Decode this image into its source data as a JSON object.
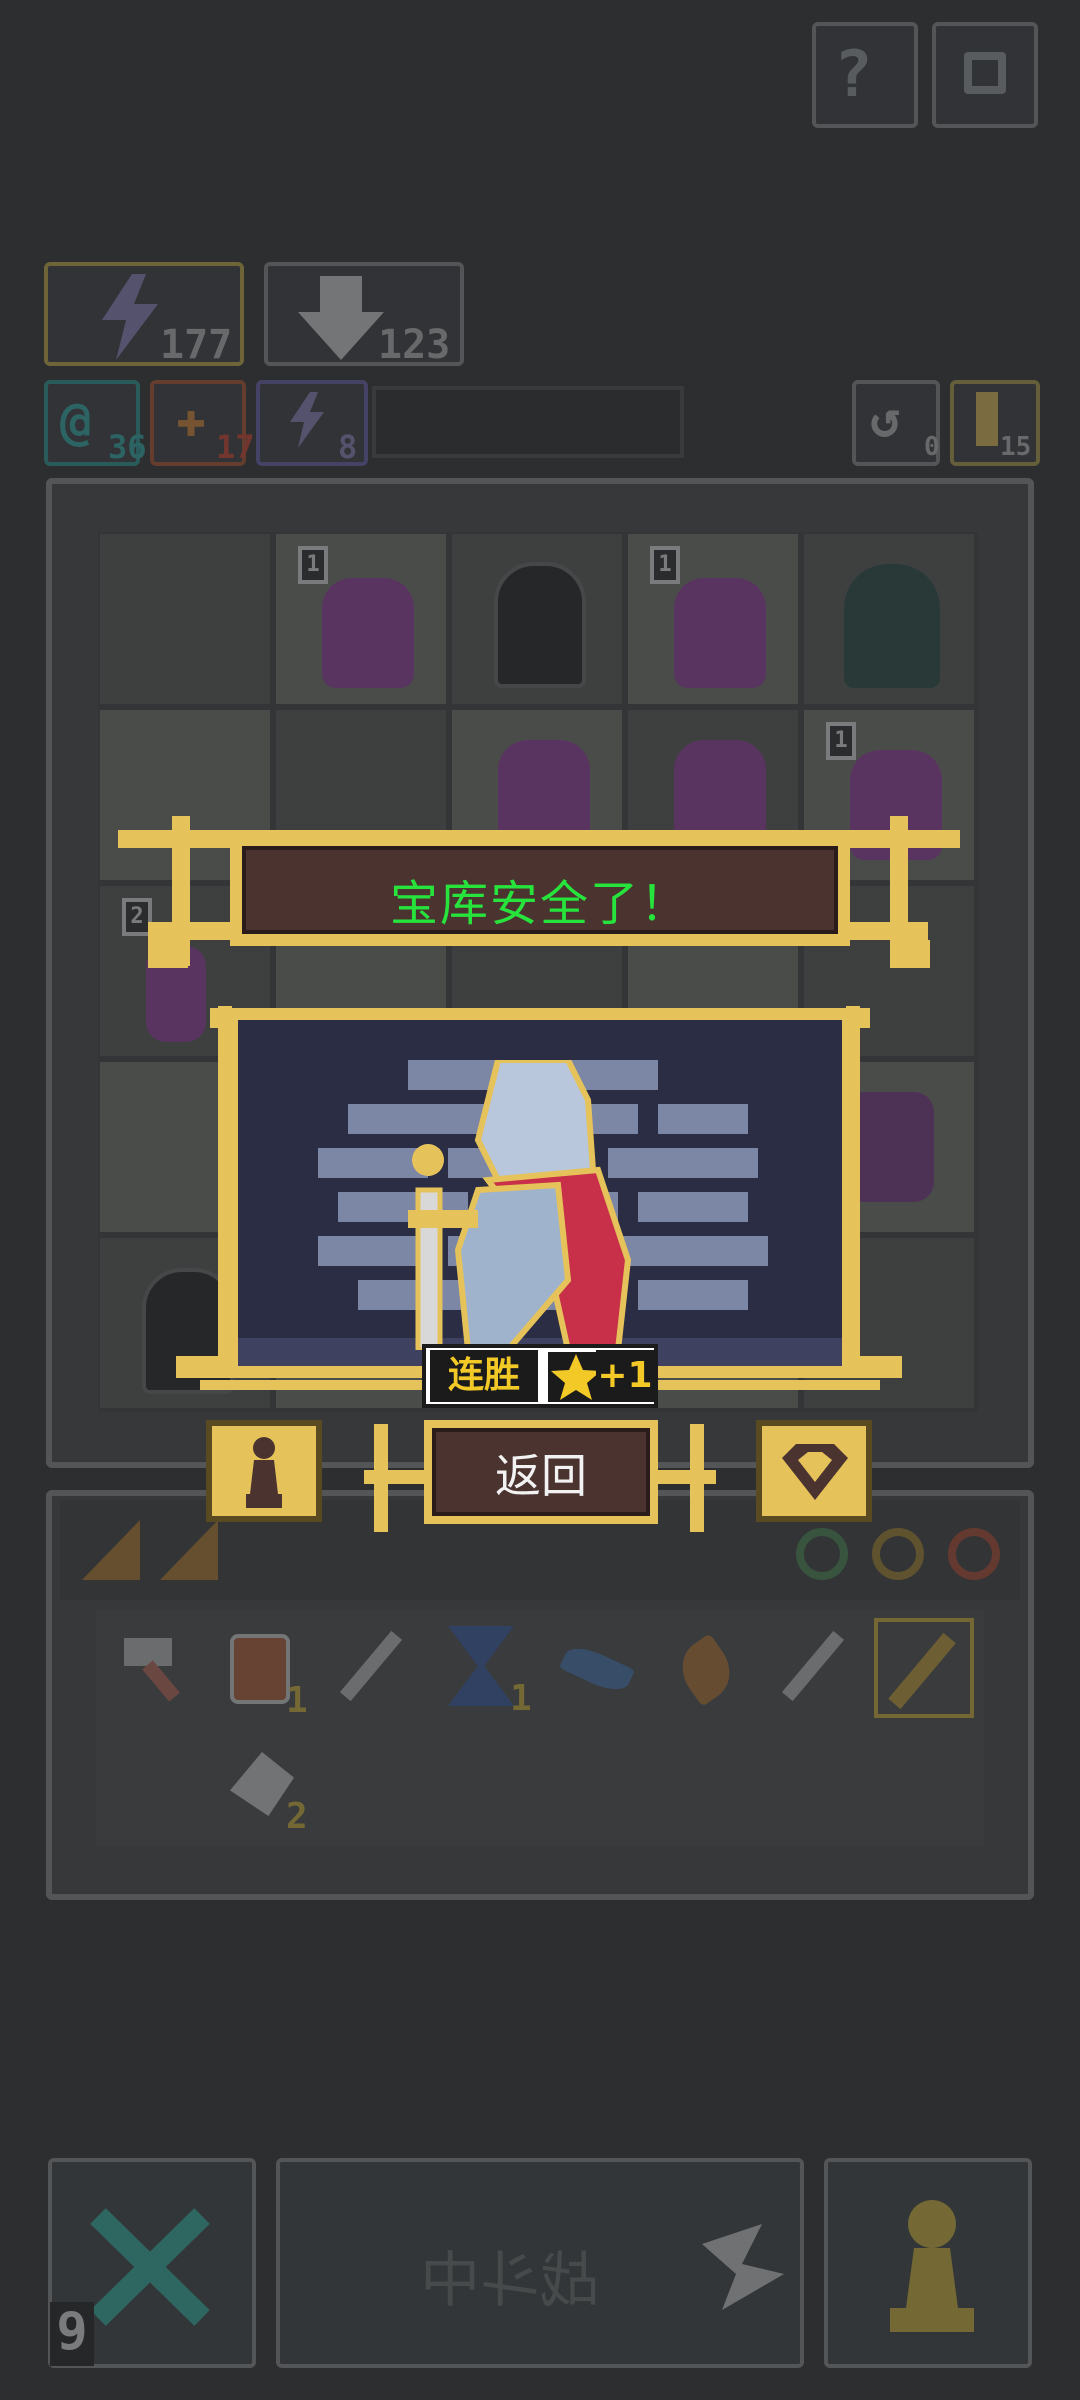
{
  "top_buttons": {
    "help_icon": "question-icon",
    "settings_icon": "gear-icon"
  },
  "stats": {
    "energy": "177",
    "shield": "123",
    "res_a": "36",
    "res_b": "17",
    "res_c": "8",
    "undo": "0",
    "keys": "15"
  },
  "grid_badges": [
    "1",
    "1",
    "1",
    "2"
  ],
  "modal": {
    "title": "宝库安全了！",
    "streak_label": "连胜",
    "streak_value": "+1",
    "back_label": "返回"
  },
  "inventory": {
    "counts": {
      "lantern": "1",
      "hourglass": "1",
      "axe": "2"
    }
  },
  "bottom_bar": {
    "moves_left": "9",
    "action_label": "战斗中"
  },
  "colors": {
    "background": "#2c2e30",
    "gold": "#e6c35a",
    "title_green": "#27e43c",
    "panel_brown": "#4b3430"
  }
}
